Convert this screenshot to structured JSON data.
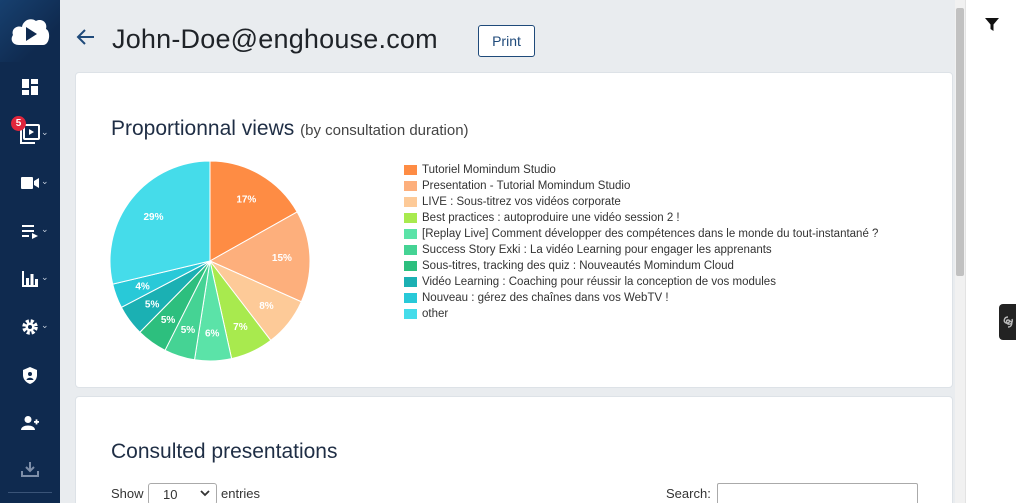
{
  "header": {
    "title": "John-Doe@enghouse.com",
    "print_label": "Print"
  },
  "sidebar": {
    "logo_icon": "cloud-play-icon",
    "items": [
      {
        "name": "dashboard",
        "icon": "dashboard-icon",
        "has_caret": false
      },
      {
        "name": "videos",
        "icon": "video-library-icon",
        "has_caret": true,
        "badge": "5"
      },
      {
        "name": "live",
        "icon": "camera-icon",
        "has_caret": true
      },
      {
        "name": "playlists",
        "icon": "playlist-icon",
        "has_caret": true
      },
      {
        "name": "statistics",
        "icon": "bar-chart-icon",
        "has_caret": true
      },
      {
        "name": "settings",
        "icon": "gear-icon",
        "has_caret": true
      },
      {
        "name": "security",
        "icon": "shield-icon",
        "has_caret": false
      },
      {
        "name": "users",
        "icon": "user-icon",
        "has_caret": false
      },
      {
        "name": "download",
        "icon": "download-icon",
        "has_caret": false
      }
    ]
  },
  "views_card": {
    "title": "Proportionnal views",
    "subtitle": "(by consultation duration)"
  },
  "chart_data": {
    "type": "pie",
    "title": "Proportionnal views",
    "subtitle": "(by consultation duration)",
    "legend_position": "right",
    "slices": [
      {
        "label": "Tutoriel Momindum Studio",
        "value": 17,
        "display": "17%",
        "color": "#fe8c44"
      },
      {
        "label": "Presentation - Tutorial Momindum Studio",
        "value": 15,
        "display": "15%",
        "color": "#fdaf7c"
      },
      {
        "label": "LIVE : Sous-titrez vos vidéos corporate",
        "value": 8,
        "display": "8%",
        "color": "#fdca98"
      },
      {
        "label": "Best practices : autoproduire une vidéo session 2 !",
        "value": 7,
        "display": "7%",
        "color": "#a8ea4e"
      },
      {
        "label": "[Replay Live] Comment développer des compétences dans le monde du tout-instantané ?",
        "value": 6,
        "display": "6%",
        "color": "#5be3a8"
      },
      {
        "label": "Success Story Exki : La vidéo Learning pour engager les apprenants",
        "value": 5,
        "display": "5%",
        "color": "#45d394"
      },
      {
        "label": "Sous-titres, tracking des quiz : Nouveautés Momindum Cloud",
        "value": 5,
        "display": "5%",
        "color": "#2dbf7e"
      },
      {
        "label": "Vidéo Learning : Coaching pour réussir la conception de vos modules",
        "value": 5,
        "display": "5%",
        "color": "#1bb0b3"
      },
      {
        "label": "Nouveau : gérez des chaînes dans vos WebTV !",
        "value": 4,
        "display": "4%",
        "color": "#28c9d8"
      },
      {
        "label": "other",
        "value": 29,
        "display": "29%",
        "color": "#45dcea"
      }
    ]
  },
  "presentations_card": {
    "title": "Consulted presentations",
    "show_label": "Show",
    "entries_value": "10",
    "entries_label": "entries",
    "search_label": "Search:",
    "search_value": ""
  },
  "right_panel": {
    "filter_icon": "filter-icon",
    "tab_icon": "swirl-icon"
  },
  "colors": {
    "sidebar_bg": "#0f2a4f",
    "accent": "#1f4a7a",
    "badge": "#e0263c"
  }
}
